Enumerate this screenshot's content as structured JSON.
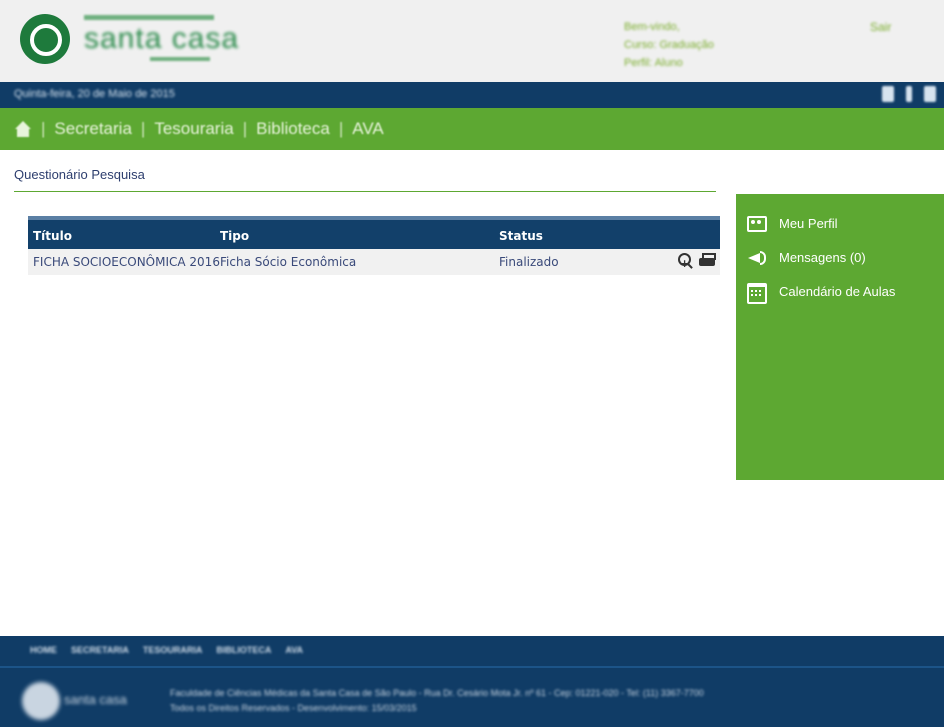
{
  "header": {
    "logo_name": "santa casa",
    "user_info": [
      "Bem-vindo,",
      "Curso: Graduação",
      "Perfil: Aluno"
    ],
    "exit_label": "Sair"
  },
  "datebar": {
    "date_text": "Quinta-feira, 20 de Maio de 2015",
    "social_icons": [
      "youtube-icon",
      "facebook-icon",
      "twitter-icon"
    ]
  },
  "nav": {
    "items": [
      "Secretaria",
      "Tesouraria",
      "Biblioteca",
      "AVA"
    ]
  },
  "page": {
    "title": "Questionário Pesquisa"
  },
  "table": {
    "columns": [
      "Título",
      "Tipo",
      "Status"
    ],
    "rows": [
      {
        "titulo": "FICHA SOCIOECONÔMICA 2016",
        "tipo": "Ficha Sócio Econômica",
        "status": "Finalizado",
        "actions": [
          "zoom-in-icon",
          "print-icon"
        ]
      }
    ]
  },
  "sidebar": {
    "items": [
      {
        "label": "Meu Perfil",
        "icon": "profile-card-icon"
      },
      {
        "label": "Mensagens (0)",
        "icon": "megaphone-icon"
      },
      {
        "label": "Calendário de Aulas",
        "icon": "calendar-icon"
      }
    ]
  },
  "footer": {
    "nav_items": [
      "HOME",
      "SECRETARIA",
      "TESOURARIA",
      "BIBLIOTECA",
      "AVA"
    ],
    "logo_name": "santa casa",
    "lines": [
      "Faculdade de Ciências Médicas da Santa Casa de São Paulo - Rua Dr. Cesário Mota Jr. nº 61 - Cep: 01221-020 - Tel: (11) 3367-7700",
      "Todos os Direitos Reservados - Desenvolvimento: 15/03/2015"
    ]
  },
  "colors": {
    "green": "#5da832",
    "navy": "#103c66",
    "table_header": "#12406a",
    "link": "#3a4a7a"
  }
}
